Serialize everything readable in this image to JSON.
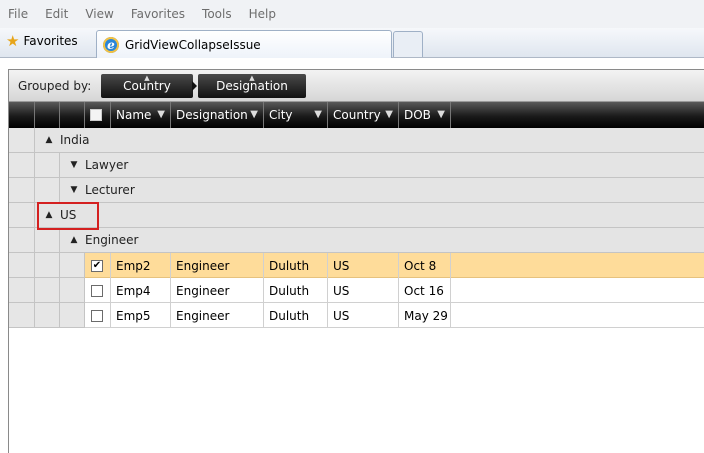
{
  "menu": [
    "File",
    "Edit",
    "View",
    "Favorites",
    "Tools",
    "Help"
  ],
  "favorites_label": "Favorites",
  "tab_title": "GridViewCollapseIssue",
  "grid": {
    "grouped_by_label": "Grouped by:",
    "group_chips": [
      "Country",
      "Designation"
    ],
    "columns": [
      "Name",
      "Designation",
      "City",
      "Country",
      "DOB"
    ],
    "groups": {
      "india": "India",
      "lawyer": "Lawyer",
      "lecturer": "Lecturer",
      "us": "US",
      "engineer": "Engineer"
    },
    "rows": [
      {
        "name": "Emp2",
        "designation": "Engineer",
        "city": "Duluth",
        "country": "US",
        "dob": "Oct 8",
        "checked": true
      },
      {
        "name": "Emp4",
        "designation": "Engineer",
        "city": "Duluth",
        "country": "US",
        "dob": "Oct 16",
        "checked": false
      },
      {
        "name": "Emp5",
        "designation": "Engineer",
        "city": "Duluth",
        "country": "US",
        "dob": "May 29",
        "checked": false
      }
    ]
  },
  "colors": {
    "selected_row": "#fedc9a",
    "highlight_box": "#d42020",
    "header_bg": "#1a1a1a"
  }
}
